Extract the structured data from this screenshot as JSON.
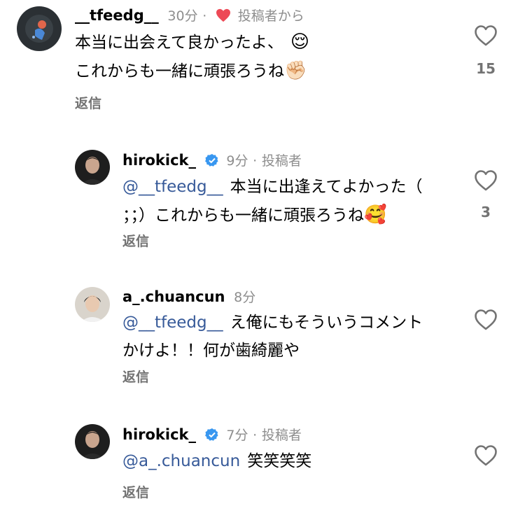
{
  "comments": [
    {
      "username": "__tfeedg__",
      "time": "30分",
      "meta_sep": "·",
      "liked_by_author": "投稿者から",
      "line1": "本当に出会えて良かったよ、",
      "line1_emoji": "😌",
      "line2": "これからも一緒に頑張ろうね",
      "line2_emoji": "✊🏻",
      "reply": "返信",
      "likes": "15"
    },
    {
      "username": "hirokick_",
      "time": "9分",
      "meta_sep": "·",
      "author_badge": "投稿者",
      "mention": "@__tfeedg__",
      "line1": "本当に出逢えてよかった（",
      "line2": "；；）これからも一緒に頑張ろうね",
      "line2_emoji": "🥰",
      "reply": "返信",
      "likes": "3"
    },
    {
      "username": "a_.chuancun",
      "time": "8分",
      "mention": "@__tfeedg__",
      "line1": "え俺にもそういうコメント",
      "line2": "かけよ！！何が歯綺麗や",
      "reply": "返信"
    },
    {
      "username": "hirokick_",
      "time": "7分",
      "meta_sep": "·",
      "author_badge": "投稿者",
      "mention": "@a_.chuancun",
      "line1": "笑笑笑笑",
      "reply": "返信"
    }
  ],
  "colors": {
    "mention": "#375a99",
    "verified": "#3897f0",
    "heart": "#ed4956",
    "meta": "#8e8e8e"
  }
}
